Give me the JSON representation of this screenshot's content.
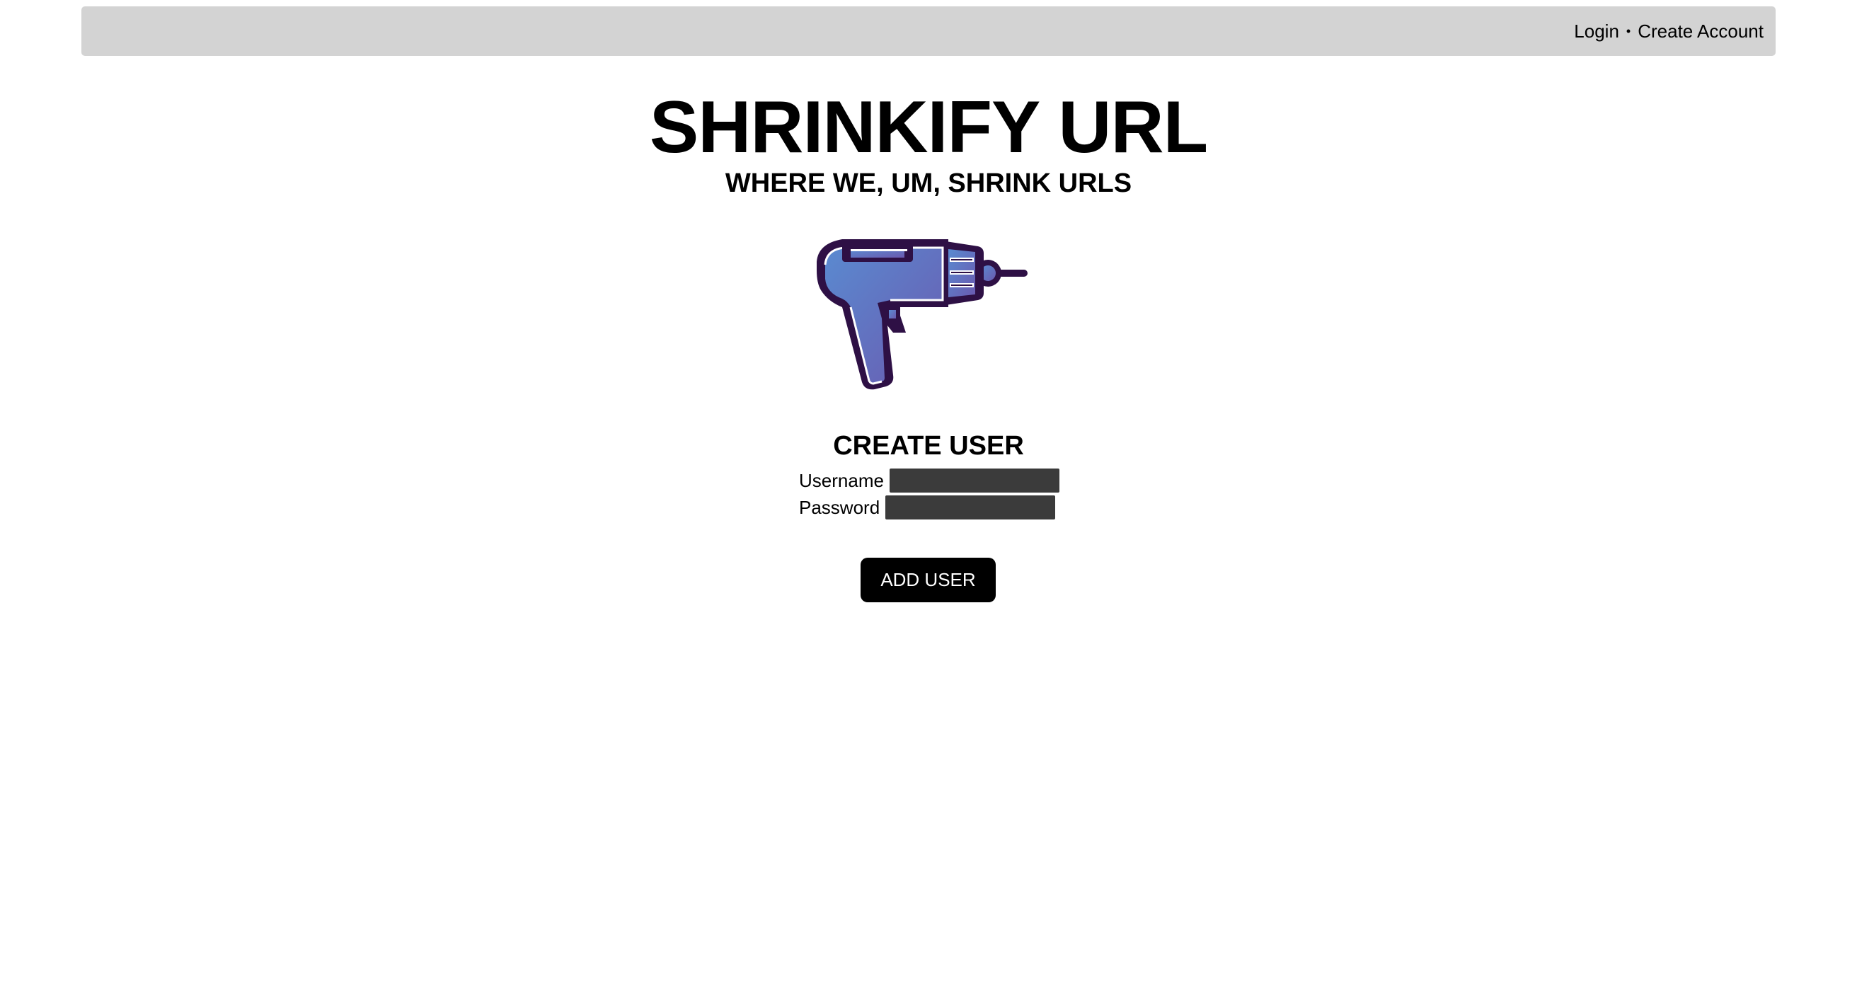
{
  "nav": {
    "login": "Login",
    "separator": "•",
    "create_account": "Create Account"
  },
  "header": {
    "title": "SHRINKIFY URL",
    "subtitle": "WHERE WE, UM, SHRINK URLS"
  },
  "logo": {
    "icon": "drill-icon",
    "outline_color": "#2e1045",
    "fill_color_start": "#5a8ad0",
    "fill_color_end": "#6a5ab0"
  },
  "form": {
    "title": "CREATE USER",
    "username_label": "Username",
    "username_value": "",
    "password_label": "Password",
    "password_value": "",
    "submit_label": "ADD USER"
  },
  "colors": {
    "topbar_bg": "#d3d3d3",
    "input_bg": "#3b3b3b",
    "button_bg": "#000000",
    "button_text": "#ffffff"
  }
}
